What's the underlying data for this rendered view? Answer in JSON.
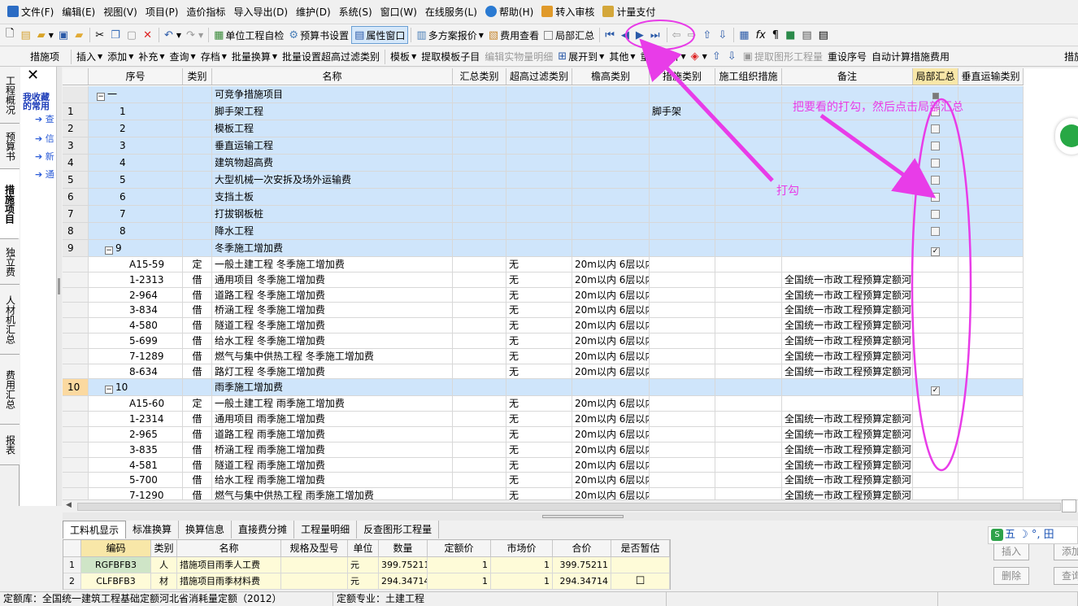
{
  "menubar": {
    "items": [
      "文件(F)",
      "编辑(E)",
      "视图(V)",
      "项目(P)",
      "造价指标",
      "导入导出(D)",
      "维护(D)",
      "系统(S)",
      "窗口(W)",
      "在线服务(L)",
      "帮助(H)",
      "转入审核",
      "计量支付"
    ]
  },
  "toolbar1": {
    "items": [
      "单位工程自检",
      "预算书设置",
      "属性窗口",
      "多方案报价",
      "费用查看",
      "局部汇总"
    ]
  },
  "toolbar2": {
    "left_label": "措施项",
    "items": [
      "插入",
      "添加",
      "补充",
      "查询",
      "存档",
      "批量换算",
      "批量设置超高过滤类别",
      "模板",
      "提取模板子目",
      "编辑实物量明细",
      "展开到",
      "其他",
      "重用组价",
      "提取图形工程量",
      "重设序号",
      "自动计算措施费用",
      "措施"
    ]
  },
  "vtabs": [
    "工程概况",
    "预算书",
    "措施项目",
    "独立费",
    "人材机汇总",
    "费用汇总",
    "报表"
  ],
  "favpanel": {
    "close": "✕",
    "title": "我收藏的常用",
    "items": [
      "➔ 查",
      "➔ 信",
      "➔ 新",
      "➔ 通"
    ]
  },
  "grid": {
    "columns": [
      "序号",
      "类别",
      "名称",
      "汇总类别",
      "超高过滤类别",
      "檐高类别",
      "措施类别",
      "施工组织措施",
      "备注",
      "局部汇总",
      "垂直运输类别"
    ],
    "rows": [
      {
        "rn": "",
        "seq": "一",
        "tree": "⊟",
        "type": "",
        "name": "可竞争措施项目",
        "filter": "",
        "eave": "",
        "cat": "",
        "note": "",
        "chk": "",
        "hl": true,
        "sub": false
      },
      {
        "rn": "1",
        "seq": "1",
        "type": "",
        "name": "脚手架工程",
        "filter": "",
        "eave": "",
        "cat": "脚手架",
        "note": "",
        "chk": "",
        "hl": true,
        "sub": false
      },
      {
        "rn": "2",
        "seq": "2",
        "type": "",
        "name": "模板工程",
        "filter": "",
        "eave": "",
        "cat": "",
        "note": "",
        "chk": "",
        "hl": true,
        "sub": false
      },
      {
        "rn": "3",
        "seq": "3",
        "type": "",
        "name": "垂直运输工程",
        "filter": "",
        "eave": "",
        "cat": "",
        "note": "",
        "chk": "",
        "hl": true,
        "sub": false
      },
      {
        "rn": "4",
        "seq": "4",
        "type": "",
        "name": "建筑物超高费",
        "filter": "",
        "eave": "",
        "cat": "",
        "note": "",
        "chk": "",
        "hl": true,
        "sub": false
      },
      {
        "rn": "5",
        "seq": "5",
        "type": "",
        "name": "大型机械一次安拆及场外运输费",
        "filter": "",
        "eave": "",
        "cat": "",
        "note": "",
        "chk": "",
        "hl": true,
        "sub": false
      },
      {
        "rn": "6",
        "seq": "6",
        "type": "",
        "name": "支挡土板",
        "filter": "",
        "eave": "",
        "cat": "",
        "note": "",
        "chk": "",
        "hl": true,
        "sub": false
      },
      {
        "rn": "7",
        "seq": "7",
        "type": "",
        "name": "打拔钢板桩",
        "filter": "",
        "eave": "",
        "cat": "",
        "note": "",
        "chk": "",
        "hl": true,
        "sub": false
      },
      {
        "rn": "8",
        "seq": "8",
        "type": "",
        "name": "降水工程",
        "filter": "",
        "eave": "",
        "cat": "",
        "note": "",
        "chk": "",
        "hl": true,
        "sub": false
      },
      {
        "rn": "9",
        "seq": "9",
        "tree": "⊟",
        "type": "",
        "name": "冬季施工增加费",
        "filter": "",
        "eave": "",
        "cat": "",
        "note": "",
        "chk": "✓",
        "hl": true,
        "sub": false
      },
      {
        "rn": "",
        "seq": "A15-59",
        "type": "定",
        "name": "一般土建工程 冬季施工增加费",
        "filter": "无",
        "eave": "20m以内 6层以内",
        "cat": "",
        "note": "",
        "chk": "",
        "hl": false,
        "sub": true
      },
      {
        "rn": "",
        "seq": "1-2313",
        "type": "借",
        "name": "通用项目 冬季施工增加费",
        "filter": "无",
        "eave": "20m以内 6层以内",
        "cat": "",
        "note": "全国统一市政工程预算定额河",
        "chk": "",
        "hl": false,
        "sub": true
      },
      {
        "rn": "",
        "seq": "2-964",
        "type": "借",
        "name": "道路工程 冬季施工增加费",
        "filter": "无",
        "eave": "20m以内 6层以内",
        "cat": "",
        "note": "全国统一市政工程预算定额河",
        "chk": "",
        "hl": false,
        "sub": true
      },
      {
        "rn": "",
        "seq": "3-834",
        "type": "借",
        "name": "桥涵工程 冬季施工增加费",
        "filter": "无",
        "eave": "20m以内 6层以内",
        "cat": "",
        "note": "全国统一市政工程预算定额河",
        "chk": "",
        "hl": false,
        "sub": true
      },
      {
        "rn": "",
        "seq": "4-580",
        "type": "借",
        "name": "隧道工程 冬季施工增加费",
        "filter": "无",
        "eave": "20m以内 6层以内",
        "cat": "",
        "note": "全国统一市政工程预算定额河",
        "chk": "",
        "hl": false,
        "sub": true
      },
      {
        "rn": "",
        "seq": "5-699",
        "type": "借",
        "name": "给水工程 冬季施工增加费",
        "filter": "无",
        "eave": "20m以内 6层以内",
        "cat": "",
        "note": "全国统一市政工程预算定额河",
        "chk": "",
        "hl": false,
        "sub": true
      },
      {
        "rn": "",
        "seq": "7-1289",
        "type": "借",
        "name": "燃气与集中供热工程 冬季施工增加费",
        "filter": "无",
        "eave": "20m以内 6层以内",
        "cat": "",
        "note": "全国统一市政工程预算定额河",
        "chk": "",
        "hl": false,
        "sub": true
      },
      {
        "rn": "",
        "seq": "8-634",
        "type": "借",
        "name": "路灯工程 冬季施工增加费",
        "filter": "无",
        "eave": "20m以内 6层以内",
        "cat": "",
        "note": "全国统一市政工程预算定额河",
        "chk": "",
        "hl": false,
        "sub": true
      },
      {
        "rn": "10",
        "seq": "10",
        "tree": "⊟",
        "type": "",
        "name": "雨季施工增加费",
        "filter": "",
        "eave": "",
        "cat": "",
        "note": "",
        "chk": "✓",
        "hl": true,
        "sub": false,
        "cur": true
      },
      {
        "rn": "",
        "seq": "A15-60",
        "type": "定",
        "name": "一般土建工程 雨季施工增加费",
        "filter": "无",
        "eave": "20m以内 6层以内",
        "cat": "",
        "note": "",
        "chk": "",
        "hl": false,
        "sub": true
      },
      {
        "rn": "",
        "seq": "1-2314",
        "type": "借",
        "name": "通用项目 雨季施工增加费",
        "filter": "无",
        "eave": "20m以内 6层以内",
        "cat": "",
        "note": "全国统一市政工程预算定额河",
        "chk": "",
        "hl": false,
        "sub": true
      },
      {
        "rn": "",
        "seq": "2-965",
        "type": "借",
        "name": "道路工程 雨季施工增加费",
        "filter": "无",
        "eave": "20m以内 6层以内",
        "cat": "",
        "note": "全国统一市政工程预算定额河",
        "chk": "",
        "hl": false,
        "sub": true
      },
      {
        "rn": "",
        "seq": "3-835",
        "type": "借",
        "name": "桥涵工程 雨季施工增加费",
        "filter": "无",
        "eave": "20m以内 6层以内",
        "cat": "",
        "note": "全国统一市政工程预算定额河",
        "chk": "",
        "hl": false,
        "sub": true
      },
      {
        "rn": "",
        "seq": "4-581",
        "type": "借",
        "name": "隧道工程 雨季施工增加费",
        "filter": "无",
        "eave": "20m以内 6层以内",
        "cat": "",
        "note": "全国统一市政工程预算定额河",
        "chk": "",
        "hl": false,
        "sub": true
      },
      {
        "rn": "",
        "seq": "5-700",
        "type": "借",
        "name": "给水工程 雨季施工增加费",
        "filter": "无",
        "eave": "20m以内 6层以内",
        "cat": "",
        "note": "全国统一市政工程预算定额河",
        "chk": "",
        "hl": false,
        "sub": true
      },
      {
        "rn": "",
        "seq": "7-1290",
        "type": "借",
        "name": "燃气与集中供热工程 雨季施工增加费",
        "filter": "无",
        "eave": "20m以内 6层以内",
        "cat": "",
        "note": "全国统一市政工程预算定额河",
        "chk": "",
        "hl": false,
        "sub": true
      }
    ]
  },
  "bottom": {
    "tabs": [
      "工料机显示",
      "标准换算",
      "换算信息",
      "直接费分摊",
      "工程量明细",
      "反查图形工程量"
    ],
    "columns": [
      "编码",
      "类别",
      "名称",
      "规格及型号",
      "单位",
      "数量",
      "定额价",
      "市场价",
      "合价",
      "是否暂估"
    ],
    "rows": [
      {
        "rn": "1",
        "code": "RGFBFB3",
        "type": "人",
        "name": "措施项目雨季人工费",
        "spec": "",
        "unit": "元",
        "qty": "399.75211",
        "quota": "1",
        "market": "1",
        "total": "399.75211",
        "est": ""
      },
      {
        "rn": "2",
        "code": "CLFBFB3",
        "type": "材",
        "name": "措施项目雨季材料费",
        "spec": "",
        "unit": "元",
        "qty": "294.34714",
        "quota": "1",
        "market": "1",
        "total": "294.34714",
        "est": "☐"
      }
    ],
    "buttons": [
      "插入",
      "添加",
      "删除",
      "查询"
    ],
    "ime": "五 ☽ °, 田"
  },
  "status": {
    "quota_lib": "定额库：全国统一建筑工程基础定额河北省消耗量定额（2012）",
    "quota_major": "定额专业：土建工程"
  },
  "annotations": {
    "instruction": "把要看的打勾，然后点击局部汇总",
    "check_label": "打勾",
    "color": "#e83ce8"
  }
}
